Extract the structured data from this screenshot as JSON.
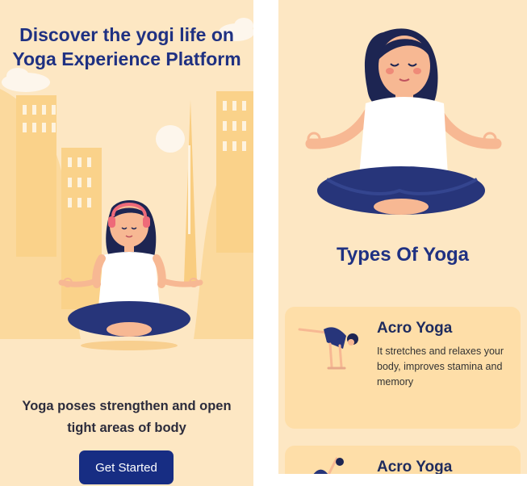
{
  "onboarding": {
    "headline": "Discover the yogi life on Yoga Experience Platform",
    "tagline": "Yoga poses strengthen and open tight areas of body",
    "cta_label": "Get Started"
  },
  "types": {
    "section_title": "Types Of Yoga",
    "cards": [
      {
        "title": "Acro Yoga",
        "description": "It stretches and relaxes your body, improves stamina and memory"
      },
      {
        "title": "Acro Yoga",
        "description": ""
      }
    ]
  },
  "colors": {
    "background": "#fde7c3",
    "card": "#fedea8",
    "primary": "#172d83",
    "heading": "#1f3182"
  }
}
